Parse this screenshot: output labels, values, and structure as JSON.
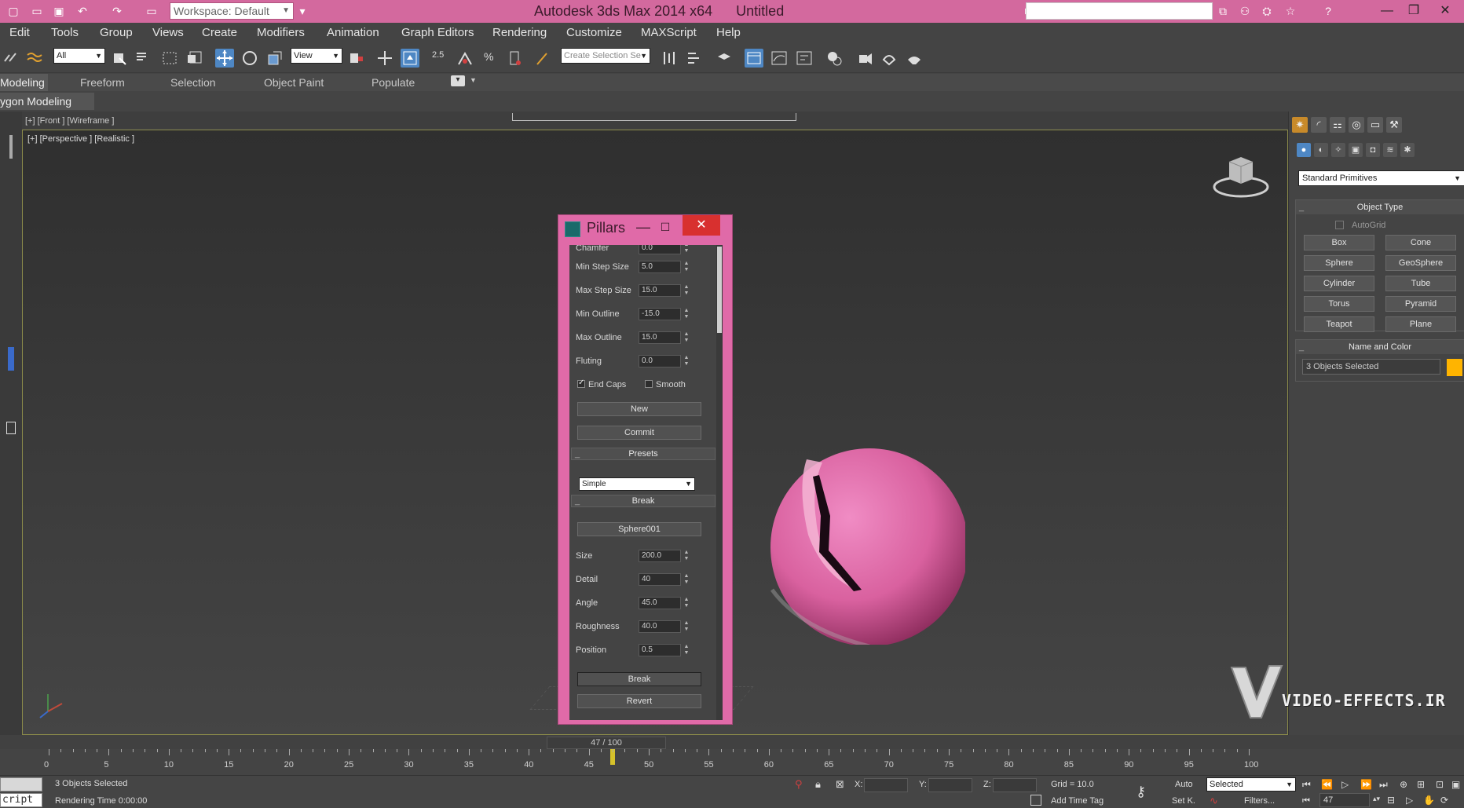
{
  "window": {
    "workspace_label": "Workspace: Default",
    "app_title": "Autodesk 3ds Max  2014 x64",
    "doc_title": "Untitled",
    "search_placeholder": ""
  },
  "menu": [
    "Edit",
    "Tools",
    "Group",
    "Views",
    "Create",
    "Modifiers",
    "Animation",
    "Graph Editors",
    "Rendering",
    "Customize",
    "MAXScript",
    "Help"
  ],
  "toolbar": {
    "filter_value": "All",
    "ref_coord_value": "View",
    "selection_set_placeholder": "Create Selection Se",
    "snap_label": "2.5"
  },
  "ribbon": {
    "tabs": [
      "Modeling",
      "Freeform",
      "Selection",
      "Object Paint",
      "Populate"
    ],
    "panel_label": "ygon Modeling"
  },
  "viewports": {
    "front_label": "[+] [Front ] [Wireframe ]",
    "persp_label": "[+] [Perspective ] [Realistic ]"
  },
  "pillars": {
    "title": "Pillars",
    "params": [
      {
        "label": "Chamfer",
        "value": "0.0"
      },
      {
        "label": "Min Step Size",
        "value": "5.0"
      },
      {
        "label": "Max Step Size",
        "value": "15.0"
      },
      {
        "label": "Min Outline",
        "value": "-15.0"
      },
      {
        "label": "Max Outline",
        "value": "15.0"
      },
      {
        "label": "Fluting",
        "value": "0.0"
      }
    ],
    "end_caps_label": "End Caps",
    "smooth_label": "Smooth",
    "new_label": "New",
    "commit_label": "Commit",
    "presets_header": "Presets",
    "preset_value": "Simple",
    "break_header": "Break",
    "object_button": "Sphere001",
    "break_params": [
      {
        "label": "Size",
        "value": "200.0"
      },
      {
        "label": "Detail",
        "value": "40"
      },
      {
        "label": "Angle",
        "value": "45.0"
      },
      {
        "label": "Roughness",
        "value": "40.0"
      },
      {
        "label": "Position",
        "value": "0.5"
      }
    ],
    "break_button": "Break",
    "revert_button": "Revert"
  },
  "command_panel": {
    "category_value": "Standard Primitives",
    "object_type_header": "Object Type",
    "autogrid_label": "AutoGrid",
    "primitives": [
      "Box",
      "Cone",
      "Sphere",
      "GeoSphere",
      "Cylinder",
      "Tube",
      "Torus",
      "Pyramid",
      "Teapot",
      "Plane"
    ],
    "name_color_header": "Name and Color",
    "name_value": "3 Objects Selected",
    "color": "#ffb400"
  },
  "timeline": {
    "frame_label": "47 / 100",
    "ticks": [
      "0",
      "5",
      "10",
      "15",
      "20",
      "25",
      "30",
      "35",
      "40",
      "45",
      "50",
      "55",
      "60",
      "65",
      "70",
      "75",
      "80",
      "85",
      "90",
      "95",
      "100"
    ],
    "current_frame": 47,
    "total_frames": 100
  },
  "status": {
    "script_label": "cript",
    "selection_text": "3 Objects Selected",
    "render_time": "Rendering Time  0:00:00",
    "x_label": "X:",
    "y_label": "Y:",
    "z_label": "Z:",
    "grid_text": "Grid = 10.0",
    "add_time_tag": "Add Time Tag",
    "auto_label": "Auto",
    "set_key_label": "Set K.",
    "key_mode_value": "Selected",
    "filters_label": "Filters...",
    "frame_value": "47"
  },
  "watermark": {
    "text": "VIDEO-EFFECTS.IR"
  },
  "colors": {
    "title_bar": "#d3699e",
    "pillars_frame": "#e06aa8",
    "sphere": "#d9619f",
    "accent_blue": "#4e87c4"
  }
}
